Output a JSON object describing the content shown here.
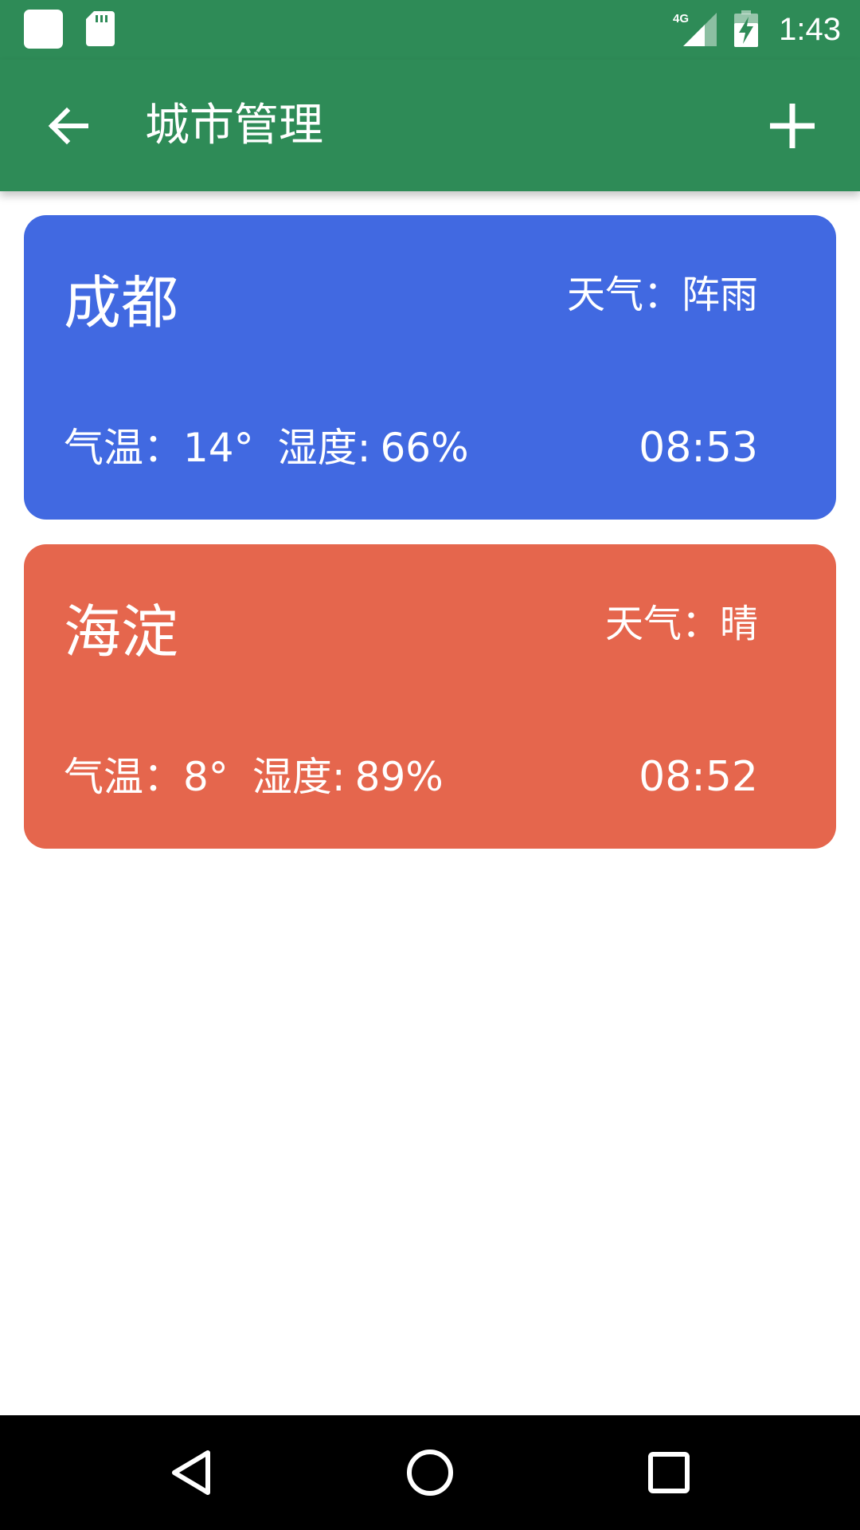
{
  "status_bar": {
    "time": "1:43",
    "network": "4G",
    "icons": [
      "notification-icon",
      "sd-card-icon",
      "signal-icon",
      "battery-charging-icon"
    ]
  },
  "app_bar": {
    "title": "城市管理",
    "back_icon": "arrow-back-icon",
    "add_icon": "add-icon"
  },
  "cities": [
    {
      "name": "成都",
      "weather_label": "天气：",
      "weather": "阵雨",
      "temp_label": "气温：",
      "temp": "14°",
      "humidity_label": "湿度:",
      "humidity": "66%",
      "time": "08:53",
      "color": "#4169e1"
    },
    {
      "name": "海淀",
      "weather_label": "天气：",
      "weather": "晴",
      "temp_label": "气温：",
      "temp": "8°",
      "humidity_label": "湿度:",
      "humidity": "89%",
      "time": "08:52",
      "color": "#e5664d"
    }
  ],
  "theme": {
    "primary": "#2e8b57",
    "navbar": "#000000"
  },
  "nav_bar": {
    "icons": [
      "back-triangle-icon",
      "home-circle-icon",
      "recents-square-icon"
    ]
  }
}
